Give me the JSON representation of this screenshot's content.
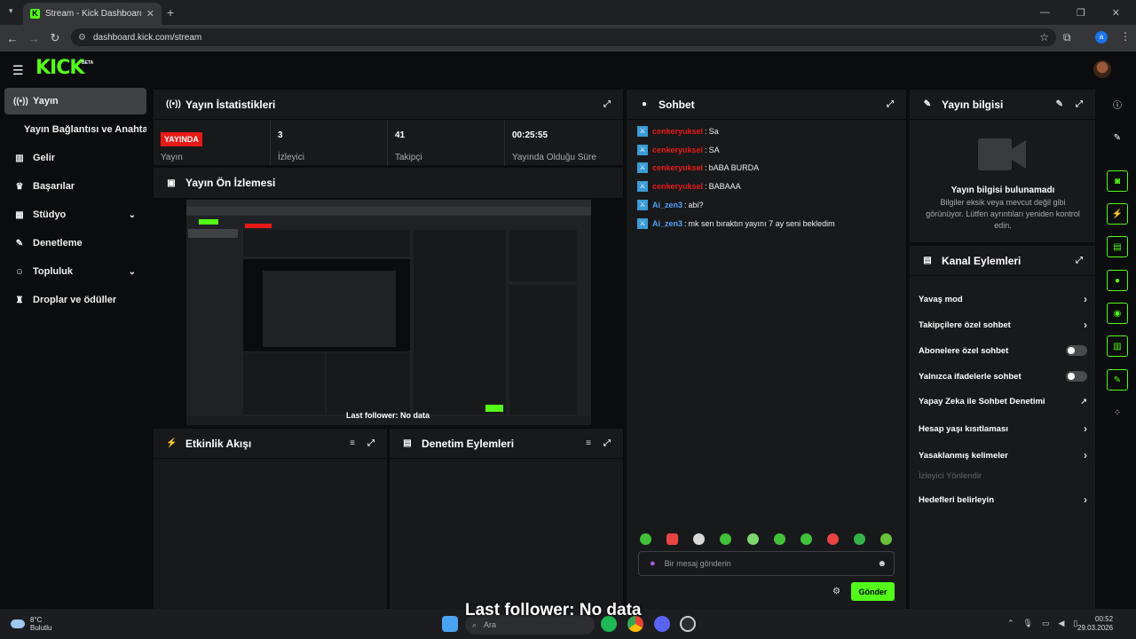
{
  "browser": {
    "tab_title": "Stream - Kick Dashboard",
    "url": "dashboard.kick.com/stream"
  },
  "header": {
    "logo": "KICK",
    "beta": "BETA"
  },
  "sidebar": {
    "items": [
      {
        "label": "Yayın",
        "icon": "broadcast-icon"
      },
      {
        "label": "Yayın Bağlantısı ve Anahtarı"
      },
      {
        "label": "Gelir",
        "icon": "chart-icon"
      },
      {
        "label": "Başarılar",
        "icon": "trophy-icon"
      },
      {
        "label": "Stüdyo",
        "icon": "studio-icon"
      },
      {
        "label": "Denetleme",
        "icon": "wrench-icon"
      },
      {
        "label": "Topluluk",
        "icon": "community-icon"
      },
      {
        "label": "Droplar ve ödüller",
        "icon": "gift-icon"
      }
    ]
  },
  "stats": {
    "title": "Yayın İstatistikleri",
    "live_badge": "YAYINDA",
    "items": [
      {
        "value": "",
        "label": "Yayın"
      },
      {
        "value": "3",
        "label": "İzleyici"
      },
      {
        "value": "41",
        "label": "Takipçi"
      },
      {
        "value": "00:25:55",
        "label": "Yayında Olduğu Süre"
      }
    ]
  },
  "preview": {
    "title": "Yayın Ön İzlemesi",
    "overlay": "Last follower: No data"
  },
  "activity": {
    "title": "Etkinlik Akışı"
  },
  "moderation": {
    "title": "Denetim Eylemleri"
  },
  "chat": {
    "title": "Sohbet",
    "messages": [
      {
        "user": "cenkeryuksel",
        "text": "Sa",
        "color": "#e91916"
      },
      {
        "user": "cenkeryuksel",
        "text": "SA",
        "color": "#e91916"
      },
      {
        "user": "cenkeryuksel",
        "text": "bABA BURDA",
        "color": "#e91916"
      },
      {
        "user": "cenkeryuksel",
        "text": "BABAAA",
        "color": "#e91916"
      },
      {
        "user": "Ai_zen3",
        "text": "abi?",
        "color": "#4fa3f7"
      },
      {
        "user": "Ai_zen3",
        "text": "mk sen bıraktın yayını 7 ay seni bekledim",
        "color": "#4fa3f7"
      }
    ],
    "input_placeholder": "Bir mesaj gönderin",
    "send_label": "Gönder"
  },
  "stream_info": {
    "title": "Yayın bilgisi",
    "empty_title": "Yayın bilgisi bulunamadı",
    "empty_text": "Bilgiler eksik veya mevcut değil gibi görünüyor. Lütfen ayrıntıları yeniden kontrol edin."
  },
  "channel_actions": {
    "title": "Kanal Eylemleri",
    "items": [
      {
        "label": "Yavaş mod",
        "control": "chevron"
      },
      {
        "label": "Takipçilere özel sohbet",
        "control": "chevron"
      },
      {
        "label": "Abonelere özel sohbet",
        "control": "toggle"
      },
      {
        "label": "Yalnızca ifadelerle sohbet",
        "control": "toggle"
      },
      {
        "label": "Yapay Zeka ile Sohbet Denetimi",
        "control": "external"
      },
      {
        "label": "Hesap yaşı kısıtlaması",
        "control": "chevron"
      },
      {
        "label": "Yasaklanmış kelimeler",
        "control": "chevron"
      },
      {
        "label": "İzleyici Yönlendir",
        "control": "none",
        "disabled": true
      },
      {
        "label": "Hedefleri belirleyin",
        "control": "chevron"
      }
    ]
  },
  "taskbar": {
    "temperature": "8°C",
    "weather": "Bulutlu",
    "search_placeholder": "Ara",
    "time": "00:52",
    "date": "29.03.2026"
  },
  "colors": {
    "accent": "#53fc18",
    "live": "#e91916"
  }
}
